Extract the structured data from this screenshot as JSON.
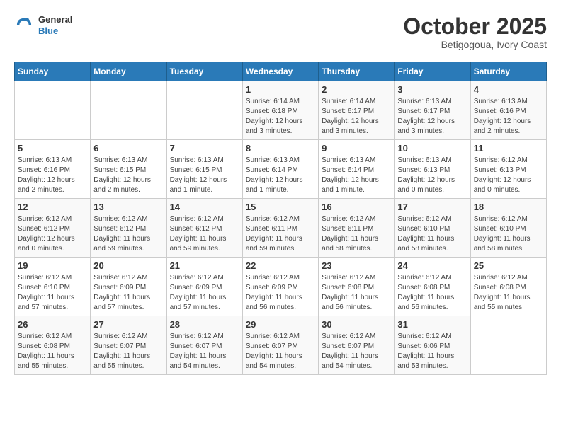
{
  "header": {
    "logo": {
      "line1": "General",
      "line2": "Blue"
    },
    "title": "October 2025",
    "subtitle": "Betigogoua, Ivory Coast"
  },
  "weekdays": [
    "Sunday",
    "Monday",
    "Tuesday",
    "Wednesday",
    "Thursday",
    "Friday",
    "Saturday"
  ],
  "weeks": [
    [
      {
        "day": "",
        "info": ""
      },
      {
        "day": "",
        "info": ""
      },
      {
        "day": "",
        "info": ""
      },
      {
        "day": "1",
        "info": "Sunrise: 6:14 AM\nSunset: 6:18 PM\nDaylight: 12 hours\nand 3 minutes."
      },
      {
        "day": "2",
        "info": "Sunrise: 6:14 AM\nSunset: 6:17 PM\nDaylight: 12 hours\nand 3 minutes."
      },
      {
        "day": "3",
        "info": "Sunrise: 6:13 AM\nSunset: 6:17 PM\nDaylight: 12 hours\nand 3 minutes."
      },
      {
        "day": "4",
        "info": "Sunrise: 6:13 AM\nSunset: 6:16 PM\nDaylight: 12 hours\nand 2 minutes."
      }
    ],
    [
      {
        "day": "5",
        "info": "Sunrise: 6:13 AM\nSunset: 6:16 PM\nDaylight: 12 hours\nand 2 minutes."
      },
      {
        "day": "6",
        "info": "Sunrise: 6:13 AM\nSunset: 6:15 PM\nDaylight: 12 hours\nand 2 minutes."
      },
      {
        "day": "7",
        "info": "Sunrise: 6:13 AM\nSunset: 6:15 PM\nDaylight: 12 hours\nand 1 minute."
      },
      {
        "day": "8",
        "info": "Sunrise: 6:13 AM\nSunset: 6:14 PM\nDaylight: 12 hours\nand 1 minute."
      },
      {
        "day": "9",
        "info": "Sunrise: 6:13 AM\nSunset: 6:14 PM\nDaylight: 12 hours\nand 1 minute."
      },
      {
        "day": "10",
        "info": "Sunrise: 6:13 AM\nSunset: 6:13 PM\nDaylight: 12 hours\nand 0 minutes."
      },
      {
        "day": "11",
        "info": "Sunrise: 6:12 AM\nSunset: 6:13 PM\nDaylight: 12 hours\nand 0 minutes."
      }
    ],
    [
      {
        "day": "12",
        "info": "Sunrise: 6:12 AM\nSunset: 6:12 PM\nDaylight: 12 hours\nand 0 minutes."
      },
      {
        "day": "13",
        "info": "Sunrise: 6:12 AM\nSunset: 6:12 PM\nDaylight: 11 hours\nand 59 minutes."
      },
      {
        "day": "14",
        "info": "Sunrise: 6:12 AM\nSunset: 6:12 PM\nDaylight: 11 hours\nand 59 minutes."
      },
      {
        "day": "15",
        "info": "Sunrise: 6:12 AM\nSunset: 6:11 PM\nDaylight: 11 hours\nand 59 minutes."
      },
      {
        "day": "16",
        "info": "Sunrise: 6:12 AM\nSunset: 6:11 PM\nDaylight: 11 hours\nand 58 minutes."
      },
      {
        "day": "17",
        "info": "Sunrise: 6:12 AM\nSunset: 6:10 PM\nDaylight: 11 hours\nand 58 minutes."
      },
      {
        "day": "18",
        "info": "Sunrise: 6:12 AM\nSunset: 6:10 PM\nDaylight: 11 hours\nand 58 minutes."
      }
    ],
    [
      {
        "day": "19",
        "info": "Sunrise: 6:12 AM\nSunset: 6:10 PM\nDaylight: 11 hours\nand 57 minutes."
      },
      {
        "day": "20",
        "info": "Sunrise: 6:12 AM\nSunset: 6:09 PM\nDaylight: 11 hours\nand 57 minutes."
      },
      {
        "day": "21",
        "info": "Sunrise: 6:12 AM\nSunset: 6:09 PM\nDaylight: 11 hours\nand 57 minutes."
      },
      {
        "day": "22",
        "info": "Sunrise: 6:12 AM\nSunset: 6:09 PM\nDaylight: 11 hours\nand 56 minutes."
      },
      {
        "day": "23",
        "info": "Sunrise: 6:12 AM\nSunset: 6:08 PM\nDaylight: 11 hours\nand 56 minutes."
      },
      {
        "day": "24",
        "info": "Sunrise: 6:12 AM\nSunset: 6:08 PM\nDaylight: 11 hours\nand 56 minutes."
      },
      {
        "day": "25",
        "info": "Sunrise: 6:12 AM\nSunset: 6:08 PM\nDaylight: 11 hours\nand 55 minutes."
      }
    ],
    [
      {
        "day": "26",
        "info": "Sunrise: 6:12 AM\nSunset: 6:08 PM\nDaylight: 11 hours\nand 55 minutes."
      },
      {
        "day": "27",
        "info": "Sunrise: 6:12 AM\nSunset: 6:07 PM\nDaylight: 11 hours\nand 55 minutes."
      },
      {
        "day": "28",
        "info": "Sunrise: 6:12 AM\nSunset: 6:07 PM\nDaylight: 11 hours\nand 54 minutes."
      },
      {
        "day": "29",
        "info": "Sunrise: 6:12 AM\nSunset: 6:07 PM\nDaylight: 11 hours\nand 54 minutes."
      },
      {
        "day": "30",
        "info": "Sunrise: 6:12 AM\nSunset: 6:07 PM\nDaylight: 11 hours\nand 54 minutes."
      },
      {
        "day": "31",
        "info": "Sunrise: 6:12 AM\nSunset: 6:06 PM\nDaylight: 11 hours\nand 53 minutes."
      },
      {
        "day": "",
        "info": ""
      }
    ]
  ]
}
